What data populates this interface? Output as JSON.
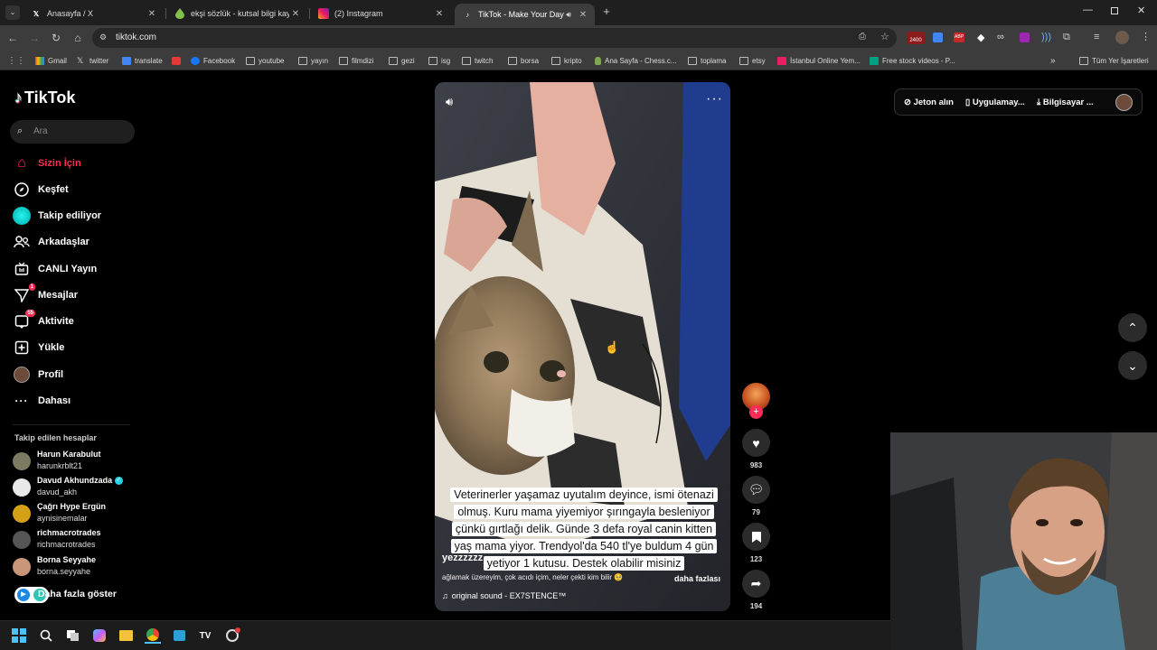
{
  "browser": {
    "tabs": [
      {
        "title": "Anasayfa / X",
        "icon": "x-icon"
      },
      {
        "title": "ekşi sözlük - kutsal bilgi kaynağı",
        "icon": "eksi-icon"
      },
      {
        "title": "(2) Instagram",
        "icon": "instagram-icon"
      },
      {
        "title": "TikTok - Make Your Day",
        "icon": "tiktok-icon",
        "active": true
      }
    ],
    "url": "tiktok.com",
    "extension_badge": "2400",
    "bookmarks": [
      "Gmail",
      "twitter",
      "translate",
      "",
      "Facebook",
      "youtube",
      "yayın",
      "filmdizi",
      "gezi",
      "isg",
      "twitch",
      "borsa",
      "kripto",
      "Ana Sayfa - Chess.c...",
      "toplama",
      "etsy",
      "İstanbul Online Yem...",
      "Free stock videos - P..."
    ],
    "all_bookmarks": "Tüm Yer İşaretleri"
  },
  "tiktok": {
    "logo": "TikTok",
    "search_placeholder": "Ara",
    "nav": [
      {
        "label": "Sizin İçin",
        "icon": "home-icon",
        "selected": true
      },
      {
        "label": "Keşfet",
        "icon": "compass-icon"
      },
      {
        "label": "Takip ediliyor",
        "icon": "following-icon"
      },
      {
        "label": "Arkadaşlar",
        "icon": "friends-icon"
      },
      {
        "label": "CANLI Yayın",
        "icon": "live-icon"
      },
      {
        "label": "Mesajlar",
        "icon": "messages-icon",
        "badge": "1"
      },
      {
        "label": "Aktivite",
        "icon": "activity-icon",
        "badge": "55"
      },
      {
        "label": "Yükle",
        "icon": "upload-icon"
      },
      {
        "label": "Profil",
        "icon": "profile-icon"
      },
      {
        "label": "Dahası",
        "icon": "more-icon"
      }
    ],
    "following_heading": "Takip edilen hesaplar",
    "following": [
      {
        "name": "Harun Karabulut",
        "username": "harunkrblt21"
      },
      {
        "name": "Davud Akhundzada",
        "username": "davud_akh",
        "verified": true
      },
      {
        "name": "Çağrı Hype Ergün",
        "username": "aynisinemalar"
      },
      {
        "name": "richmacrotrades",
        "username": "richmacrotrades"
      },
      {
        "name": "Borna Seyyahe",
        "username": "borna.seyyahe"
      }
    ],
    "show_more": "Daha fazla göster",
    "video": {
      "caption": "Veterinerler yaşamaz uyutalım deyince, ismi ötenazi olmuş. Kuru mama yiyemiyor şırıngayla besleniyor çünkü gırtlağı delik. Günde 3 defa royal canin kitten yaş mama yiyor. Trendyol'da 540 tl'ye buldum 4 gün yetiyor 1 kutusu. Destek olabilir misiniz",
      "username": "yezzzzzz",
      "description": "ağlamak üzereyim, çok acıdı içim, neler çekti kim bilir 🥺",
      "more_label": "daha fazlası",
      "sound": "original sound - EX7STENCE™"
    },
    "actions": {
      "likes": "983",
      "comments": "79",
      "saves": "123",
      "shares": "194"
    },
    "header": {
      "coins": "Jeton alın",
      "app": "Uygulamay...",
      "desktop": "Bilgisayar ..."
    }
  }
}
